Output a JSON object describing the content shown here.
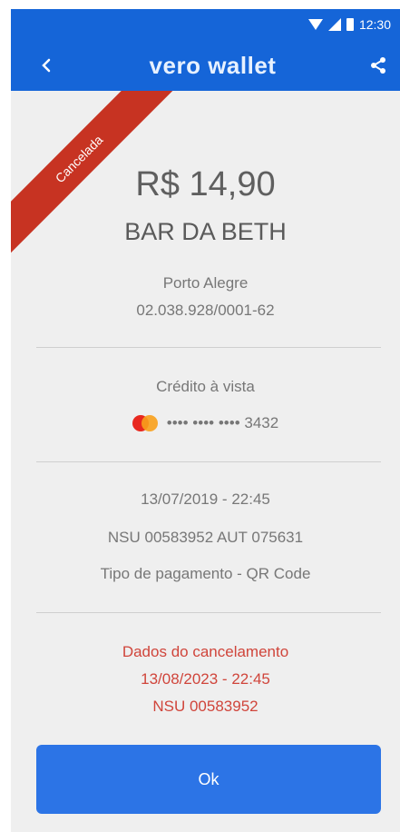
{
  "status_bar": {
    "time": "12:30"
  },
  "app_bar": {
    "brand": "vero wallet",
    "back_icon": "chevron-left-icon",
    "share_icon": "share-icon"
  },
  "receipt": {
    "badge": "Cancelada",
    "amount": "R$ 14,90",
    "merchant": "BAR DA BETH",
    "city": "Porto Alegre",
    "cnpj": "02.038.928/0001-62",
    "payment_method": "Crédito à vista",
    "card_number": "•••• •••• •••• 3432",
    "transaction_date": "13/07/2019 - 22:45",
    "nsu_aut": "NSU 00583952  AUT 075631",
    "payment_type": "Tipo de pagamento - QR Code",
    "cancellation_title": "Dados do cancelamento",
    "cancellation_date": "13/08/2023 - 22:45",
    "cancellation_nsu": "NSU 00583952"
  },
  "actions": {
    "ok_label": "Ok"
  },
  "colors": {
    "primary_blue": "#1565d8",
    "button_blue": "#2c74e6",
    "cancel_red": "#c73322",
    "cancel_text_red": "#d0453b",
    "background_gray": "#efefef"
  }
}
